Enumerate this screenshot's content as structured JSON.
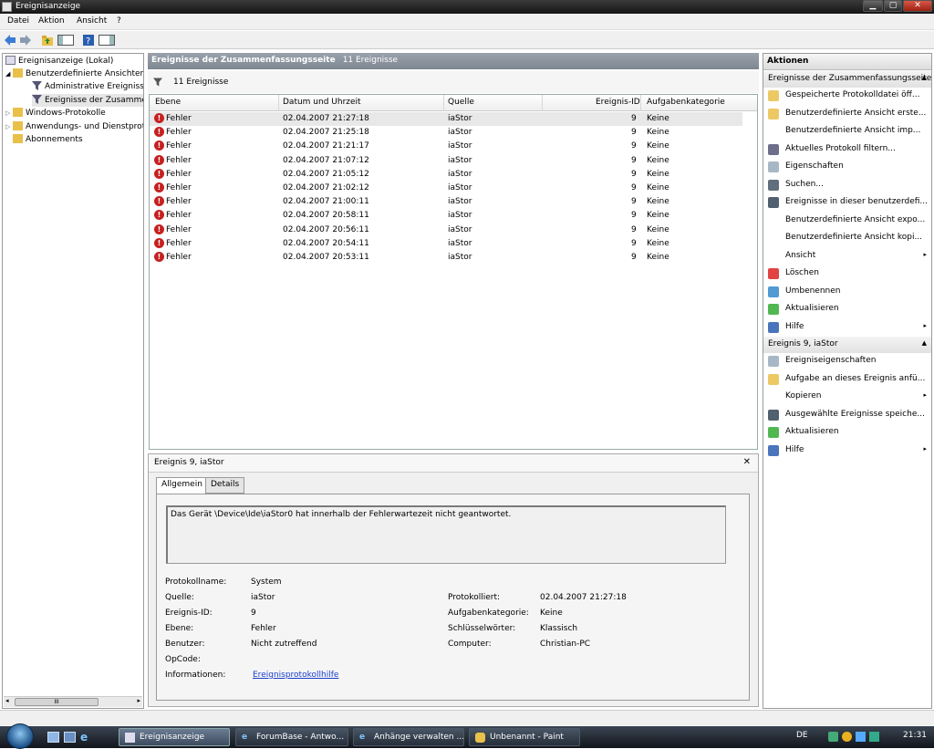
{
  "window": {
    "title": "Ereignisanzeige",
    "min_label": "▁",
    "max_label": "▢",
    "close_label": "✕"
  },
  "menu": [
    "Datei",
    "Aktion",
    "Ansicht",
    "?"
  ],
  "tree": {
    "root": "Ereignisanzeige (Lokal)",
    "custom_views": "Benutzerdefinierte Ansichten",
    "admin_events": "Administrative Ereignisse",
    "summary_events": "Ereignisse der Zusammenfassungsseite",
    "windows_logs": "Windows-Protokolle",
    "app_logs": "Anwendungs- und Dienstprotokolle",
    "subscriptions": "Abonnements",
    "scroll_grip": "III"
  },
  "center": {
    "title": "Ereignisse der Zusammenfassungsseite",
    "count": "11 Ereignisse",
    "filter_text": "11 Ereignisse",
    "columns": [
      "Ebene",
      "Datum und Uhrzeit",
      "Quelle",
      "Ereignis-ID",
      "Aufgabenkategorie"
    ],
    "rows": [
      {
        "level": "Fehler",
        "datetime": "02.04.2007 21:27:18",
        "source": "iaStor",
        "id": "9",
        "category": "Keine"
      },
      {
        "level": "Fehler",
        "datetime": "02.04.2007 21:25:18",
        "source": "iaStor",
        "id": "9",
        "category": "Keine"
      },
      {
        "level": "Fehler",
        "datetime": "02.04.2007 21:21:17",
        "source": "iaStor",
        "id": "9",
        "category": "Keine"
      },
      {
        "level": "Fehler",
        "datetime": "02.04.2007 21:07:12",
        "source": "iaStor",
        "id": "9",
        "category": "Keine"
      },
      {
        "level": "Fehler",
        "datetime": "02.04.2007 21:05:12",
        "source": "iaStor",
        "id": "9",
        "category": "Keine"
      },
      {
        "level": "Fehler",
        "datetime": "02.04.2007 21:02:12",
        "source": "iaStor",
        "id": "9",
        "category": "Keine"
      },
      {
        "level": "Fehler",
        "datetime": "02.04.2007 21:00:11",
        "source": "iaStor",
        "id": "9",
        "category": "Keine"
      },
      {
        "level": "Fehler",
        "datetime": "02.04.2007 20:58:11",
        "source": "iaStor",
        "id": "9",
        "category": "Keine"
      },
      {
        "level": "Fehler",
        "datetime": "02.04.2007 20:56:11",
        "source": "iaStor",
        "id": "9",
        "category": "Keine"
      },
      {
        "level": "Fehler",
        "datetime": "02.04.2007 20:54:11",
        "source": "iaStor",
        "id": "9",
        "category": "Keine"
      },
      {
        "level": "Fehler",
        "datetime": "02.04.2007 20:53:11",
        "source": "iaStor",
        "id": "9",
        "category": "Keine"
      }
    ]
  },
  "detail": {
    "title": "Ereignis 9, iaStor",
    "close": "✕",
    "tabs": [
      "Allgemein",
      "Details"
    ],
    "message": "Das Gerät \\Device\\Ide\\iaStor0 hat innerhalb der Fehlerwartezeit nicht geantwortet.",
    "labels": {
      "log_name": "Protokollname:",
      "source": "Quelle:",
      "event_id": "Ereignis-ID:",
      "level": "Ebene:",
      "user": "Benutzer:",
      "opcode": "OpCode:",
      "info": "Informationen:",
      "logged": "Protokolliert:",
      "task_category": "Aufgabenkategorie:",
      "keywords": "Schlüsselwörter:",
      "computer": "Computer:"
    },
    "values": {
      "log_name": "System",
      "source": "iaStor",
      "event_id": "9",
      "level": "Fehler",
      "user": "Nicht zutreffend",
      "info_link": "Ereignisprotokollhilfe",
      "logged": "02.04.2007 21:27:18",
      "task_category": "Keine",
      "keywords": "Klassisch",
      "computer": "Christian-PC"
    }
  },
  "actions": {
    "title": "Aktionen",
    "section1": "Ereignisse der Zusammenfassungsseite",
    "items1": [
      "Gespeicherte Protokolldatei öff...",
      "Benutzerdefinierte Ansicht erste...",
      "Benutzerdefinierte Ansicht imp...",
      "Aktuelles Protokoll filtern...",
      "Eigenschaften",
      "Suchen...",
      "Ereignisse in dieser benutzerdefi...",
      "Benutzerdefinierte Ansicht expo...",
      "Benutzerdefinierte Ansicht kopi...",
      "Ansicht",
      "Löschen",
      "Umbenennen",
      "Aktualisieren",
      "Hilfe"
    ],
    "section2": "Ereignis 9, iaStor",
    "items2": [
      "Ereigniseigenschaften",
      "Aufgabe an dieses Ereignis anfü...",
      "Kopieren",
      "Ausgewählte Ereignisse speiche...",
      "Aktualisieren",
      "Hilfe"
    ],
    "arrow": "▸",
    "collapse": "▲"
  },
  "taskbar": {
    "tasks": [
      "Ereignisanzeige",
      "ForumBase - Antwo...",
      "Anhänge verwalten ...",
      "Unbenannt - Paint"
    ],
    "lang": "DE",
    "time": "21:31"
  },
  "colors": {
    "accent": "#3c4a5e",
    "error": "#c62020",
    "link": "#1a3ecf"
  }
}
